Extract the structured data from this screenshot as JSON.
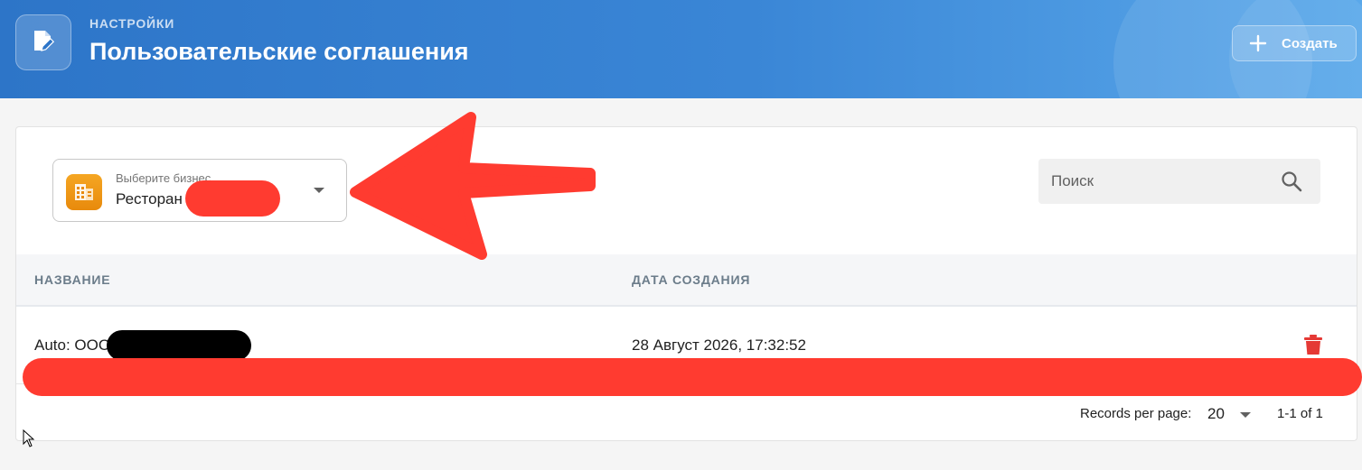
{
  "header": {
    "overline": "НАСТРОЙКИ",
    "title": "Пользовательские соглашения",
    "icon": "edit-document-icon",
    "create_label": "Создать",
    "create_icon": "plus-icon"
  },
  "filters": {
    "business_label": "Выберите бизнес",
    "business_value": "Ресторан",
    "business_icon": "building-icon",
    "search_placeholder": "Поиск"
  },
  "table": {
    "columns": [
      "НАЗВАНИЕ",
      "ДАТА СОЗДАНИЯ"
    ],
    "rows": [
      {
        "name": "Auto: ООО",
        "created": "28 Август 2026, 17:32:52"
      }
    ]
  },
  "pagination": {
    "records_per_page_label": "Records per page:",
    "per_page": "20",
    "range": "1-1 of 1"
  },
  "colors": {
    "header_start": "#2d75c8",
    "header_end": "#5aa8ea",
    "business_icon_bg": "#f5a623",
    "delete": "#e53935",
    "annotation": "#ff3b30"
  }
}
